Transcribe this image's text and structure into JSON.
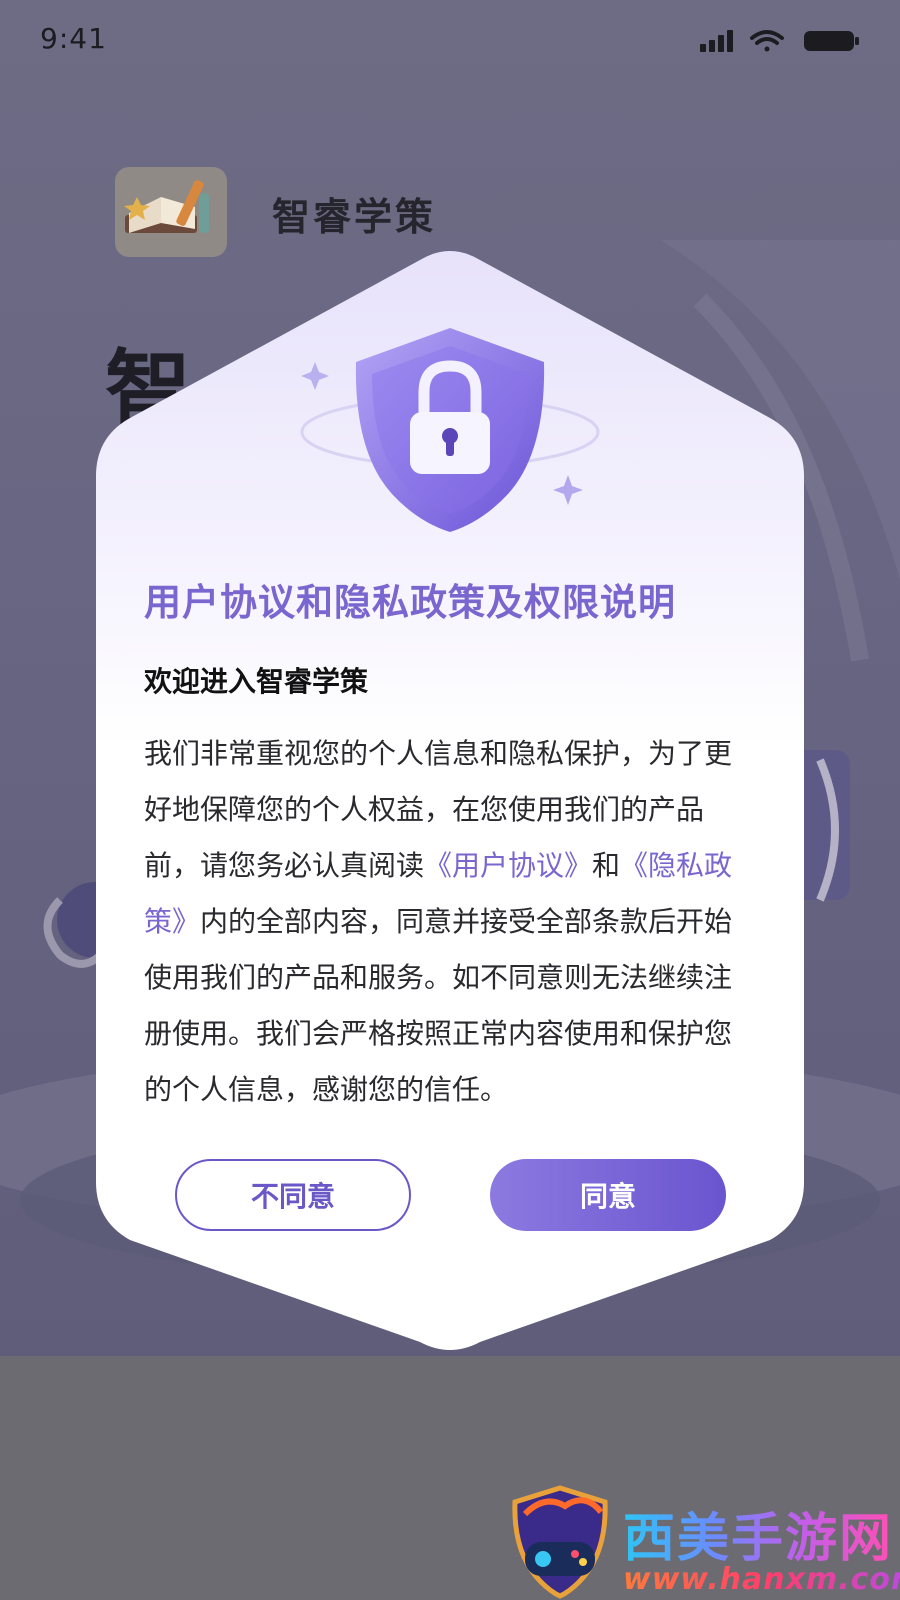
{
  "status_bar": {
    "time": "9:41"
  },
  "app": {
    "name": "智睿学策",
    "big_title": "智"
  },
  "dialog": {
    "title": "用户协议和隐私政策及权限说明",
    "subtitle": "欢迎进入智睿学策",
    "body": {
      "intro": "我们非常重视您的个人信息和隐私保护，为了更好地保障您的个人权益，在您使用我们的产品前，请您务必认真阅读",
      "user_agreement_link": "《用户协议》",
      "and": "和",
      "privacy_policy_link": "《隐私政策》",
      "rest": "内的全部内容，同意并接受全部条款后开始使用我们的产品和服务。如不同意则无法继续注册使用。我们会严格按照正常内容使用和保护您的个人信息，感谢您的信任。"
    },
    "disagree_label": "不同意",
    "agree_label": "同意"
  },
  "watermark": {
    "title": "西美手游网",
    "url": "www.hanxm.com"
  },
  "colors": {
    "accent": "#7a66cf",
    "overlay": "#6b6b71",
    "button_gradient_start": "#8c7ae0",
    "button_gradient_end": "#6a55cf"
  }
}
